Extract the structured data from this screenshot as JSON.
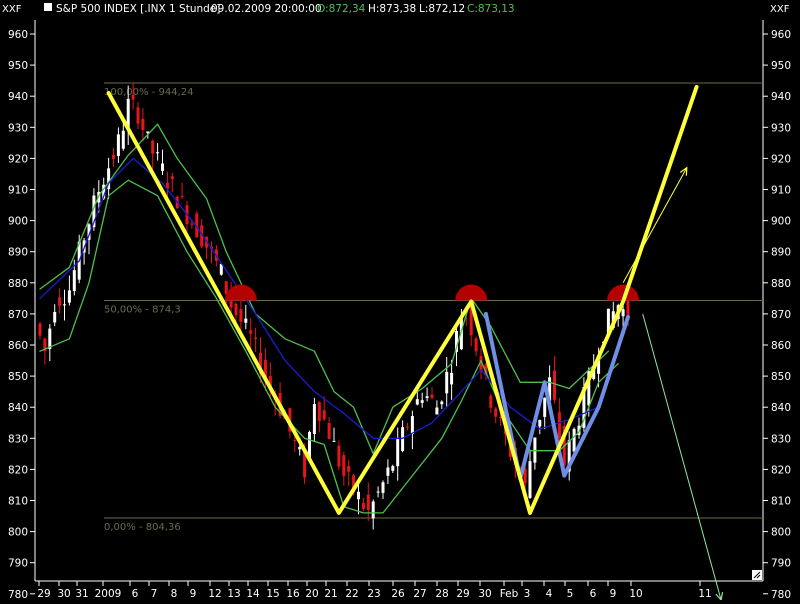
{
  "header": {
    "symbol": "S&P 500 INDEX [.INX  1 Stunde]",
    "datetime": "09.02.2009 20:00:00",
    "open": "O:872,34",
    "high": "H:873,38",
    "low": "L:872,12",
    "close": "C:873,13",
    "axis_tag": "XXF"
  },
  "colors": {
    "background": "#000000",
    "axis": "#ffffff",
    "grid_line": "#6b6b4a",
    "fib_text": "#6b6b4a",
    "up_candle": "#ffffff",
    "down_candle": "#e8141c",
    "ma_blue": "#1c1ccf",
    "band_green": "#4ec04e",
    "zigzag_yellow": "#ffff3a",
    "zigzag_blue": "#6f8fe6",
    "semicircle_red": "#b30000",
    "projection_arrow": "#8fe8a0"
  },
  "chart_data": {
    "type": "candlestick",
    "ylim": [
      775,
      965
    ],
    "y_ticks": [
      960,
      950,
      940,
      930,
      920,
      910,
      900,
      890,
      880,
      870,
      860,
      850,
      840,
      830,
      820,
      810,
      800,
      790,
      780
    ],
    "x_labels": [
      "29",
      "30",
      "31",
      "2009",
      "6",
      "7",
      "8",
      "9",
      "12",
      "13",
      "14",
      "15",
      "16",
      "20",
      "21",
      "22",
      "23",
      "26",
      "27",
      "28",
      "29",
      "30",
      "Feb",
      "3",
      "4",
      "5",
      "6",
      "9",
      "10",
      "11"
    ],
    "fib_levels": [
      {
        "label": "100,00% - 944,24",
        "value": 944.24
      },
      {
        "label": "50,00% - 874,3",
        "value": 874.3
      },
      {
        "label": "0,00% - 804,36",
        "value": 804.36
      }
    ],
    "candle_path": [
      [
        0,
        867
      ],
      [
        2,
        858
      ],
      [
        4,
        874
      ],
      [
        7,
        878
      ],
      [
        10,
        895
      ],
      [
        13,
        910
      ],
      [
        17,
        925
      ],
      [
        19,
        937
      ],
      [
        21,
        935
      ],
      [
        23,
        925
      ],
      [
        27,
        913
      ],
      [
        30,
        905
      ],
      [
        34,
        895
      ],
      [
        38,
        883
      ],
      [
        40,
        873
      ],
      [
        44,
        862
      ],
      [
        47,
        850
      ],
      [
        50,
        840
      ],
      [
        53,
        828
      ],
      [
        55,
        820
      ],
      [
        57,
        843
      ],
      [
        60,
        832
      ],
      [
        63,
        818
      ],
      [
        66,
        811
      ],
      [
        68,
        806
      ],
      [
        70,
        812
      ],
      [
        73,
        822
      ],
      [
        76,
        835
      ],
      [
        79,
        845
      ],
      [
        82,
        840
      ],
      [
        85,
        855
      ],
      [
        87,
        870
      ],
      [
        88,
        872
      ],
      [
        90,
        860
      ],
      [
        92,
        847
      ],
      [
        95,
        834
      ],
      [
        98,
        822
      ],
      [
        100,
        814
      ],
      [
        102,
        832
      ],
      [
        105,
        848
      ],
      [
        106,
        840
      ],
      [
        108,
        822
      ],
      [
        110,
        832
      ],
      [
        113,
        848
      ],
      [
        116,
        865
      ],
      [
        119,
        873
      ],
      [
        120,
        871
      ]
    ],
    "candle_count": 121,
    "blue_ma": [
      [
        0,
        875
      ],
      [
        8,
        887
      ],
      [
        14,
        912
      ],
      [
        19,
        920
      ],
      [
        25,
        912
      ],
      [
        32,
        898
      ],
      [
        38,
        884
      ],
      [
        44,
        870
      ],
      [
        50,
        855
      ],
      [
        56,
        845
      ],
      [
        62,
        838
      ],
      [
        68,
        830
      ],
      [
        74,
        830
      ],
      [
        80,
        835
      ],
      [
        86,
        845
      ],
      [
        90,
        852
      ],
      [
        96,
        840
      ],
      [
        102,
        833
      ],
      [
        108,
        836
      ],
      [
        114,
        840
      ]
    ],
    "green_upper": [
      [
        0,
        878
      ],
      [
        6,
        885
      ],
      [
        12,
        908
      ],
      [
        18,
        921
      ],
      [
        24,
        931
      ],
      [
        28,
        920
      ],
      [
        34,
        907
      ],
      [
        38,
        890
      ],
      [
        44,
        870
      ],
      [
        50,
        862
      ],
      [
        56,
        858
      ],
      [
        60,
        845
      ],
      [
        64,
        840
      ],
      [
        68,
        825
      ],
      [
        72,
        840
      ],
      [
        78,
        846
      ],
      [
        84,
        854
      ],
      [
        88,
        875
      ],
      [
        92,
        866
      ],
      [
        98,
        848
      ],
      [
        104,
        848
      ],
      [
        108,
        846
      ],
      [
        112,
        852
      ],
      [
        116,
        858
      ]
    ],
    "green_lower": [
      [
        0,
        858
      ],
      [
        6,
        862
      ],
      [
        10,
        880
      ],
      [
        14,
        908
      ],
      [
        18,
        913
      ],
      [
        24,
        908
      ],
      [
        30,
        890
      ],
      [
        36,
        875
      ],
      [
        42,
        858
      ],
      [
        48,
        840
      ],
      [
        54,
        830
      ],
      [
        58,
        828
      ],
      [
        62,
        808
      ],
      [
        66,
        806
      ],
      [
        70,
        806
      ],
      [
        76,
        818
      ],
      [
        82,
        830
      ],
      [
        86,
        842
      ],
      [
        90,
        855
      ],
      [
        94,
        840
      ],
      [
        100,
        826
      ],
      [
        106,
        826
      ],
      [
        110,
        832
      ],
      [
        114,
        848
      ],
      [
        118,
        854
      ]
    ],
    "yellow_zigzag": [
      [
        14,
        941
      ],
      [
        61,
        806
      ],
      [
        88,
        874
      ],
      [
        100,
        806
      ],
      [
        119,
        874
      ],
      [
        134,
        943
      ]
    ],
    "blue_zigzag": [
      [
        91,
        870
      ],
      [
        98,
        817
      ],
      [
        103,
        848
      ],
      [
        107,
        818
      ],
      [
        114,
        840
      ],
      [
        120,
        869
      ]
    ],
    "red_semicircles": [
      [
        41,
        874.3
      ],
      [
        88,
        874.3
      ],
      [
        119,
        874.3
      ]
    ],
    "projection_arrows": [
      {
        "from": [
          119,
          880
        ],
        "to": [
          132,
          917
        ]
      },
      {
        "from": [
          123,
          870
        ],
        "to": [
          139,
          778
        ]
      }
    ]
  }
}
